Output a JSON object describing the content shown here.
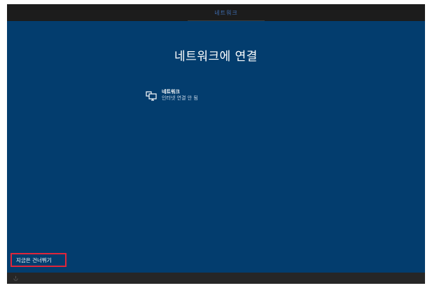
{
  "window": {
    "tab_label": "네트워크"
  },
  "main": {
    "title": "네트워크에 연결",
    "network": {
      "name": "네트워크",
      "status": "인터넷 연결 안 됨",
      "icon": "wired-network-icon"
    },
    "skip_label": "지금은 건너뛰기"
  },
  "footer": {
    "icon": "ease-of-access-icon"
  },
  "colors": {
    "background": "#033d6e",
    "topbar": "#1c1c1c",
    "highlight_border": "#e0263a",
    "tab_text": "#3f6fb5"
  }
}
